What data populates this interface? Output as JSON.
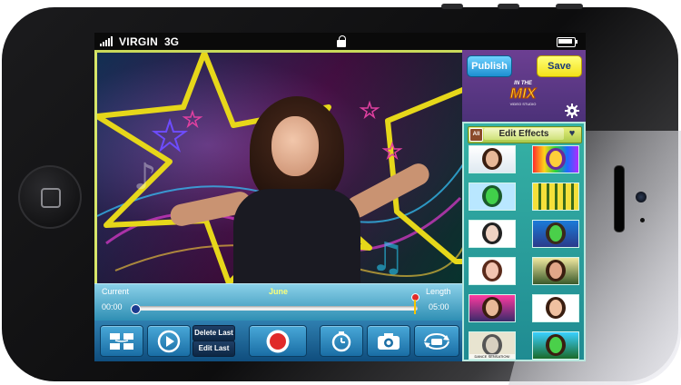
{
  "status_bar": {
    "carrier": "VIRGIN",
    "network": "3G"
  },
  "video": {
    "song_title": "June"
  },
  "timeline": {
    "current_label": "Current",
    "current_time": "00:00",
    "length_label": "Length",
    "length_time": "05:00",
    "progress": 0.0
  },
  "toolbar": {
    "delete_last_label": "Delete Last",
    "edit_last_label": "Edit Last"
  },
  "right_panel": {
    "publish_label": "Publish",
    "save_label": "Save",
    "logo": {
      "top": "IN THE",
      "main": "MIX",
      "sub": "VIDEO STUDIO"
    },
    "effects_all_label": "All",
    "effects_title": "Edit Effects",
    "thumbnail_caption": "DANCE SENSATION!"
  },
  "colors": {
    "publish": "#1d8fd1",
    "save": "#f3e21a",
    "timeline": "#2f8fb4",
    "toolbar": "#0f4d7d",
    "record_red": "#e02a2a",
    "effects_panel": "#1f8b92"
  },
  "icons": {
    "toolbar": [
      "swap-clips-icon",
      "play-icon",
      "record-icon",
      "timer-icon",
      "camera-icon",
      "switch-camera-icon"
    ],
    "panel": [
      "gear-icon",
      "heart-icon"
    ],
    "status": [
      "signal-icon",
      "lock-icon",
      "battery-icon"
    ]
  }
}
